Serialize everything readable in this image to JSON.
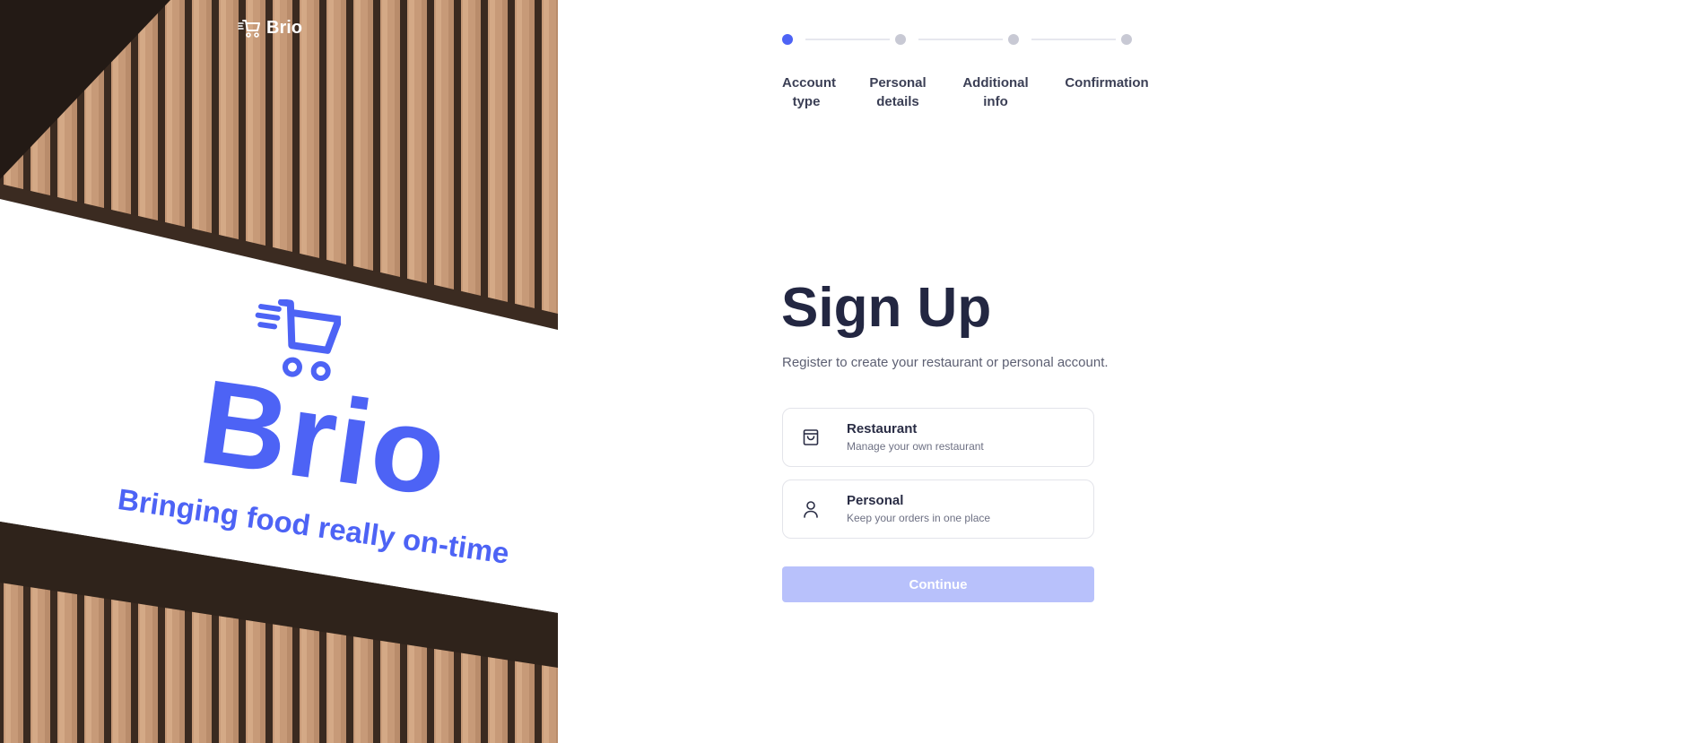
{
  "brand": {
    "name": "Brio"
  },
  "hero": {
    "sign_word": "Brio",
    "tagline": "Bringing food really on-time"
  },
  "steps": [
    {
      "label": "Account type",
      "active": true
    },
    {
      "label": "Personal details",
      "active": false
    },
    {
      "label": "Additional info",
      "active": false
    },
    {
      "label": "Confirmation",
      "active": false
    }
  ],
  "form": {
    "title": "Sign Up",
    "subtitle": "Register to create your restaurant or personal account.",
    "options": [
      {
        "name": "Restaurant",
        "description": "Manage your own restaurant",
        "icon": "shopping-bag-icon"
      },
      {
        "name": "Personal",
        "description": "Keep your orders in one place",
        "icon": "user-icon"
      }
    ],
    "continue_label": "Continue"
  },
  "colors": {
    "accent": "#4d63f5",
    "accent_disabled": "#b8c1fb",
    "step_inactive": "#c8c9d4"
  }
}
